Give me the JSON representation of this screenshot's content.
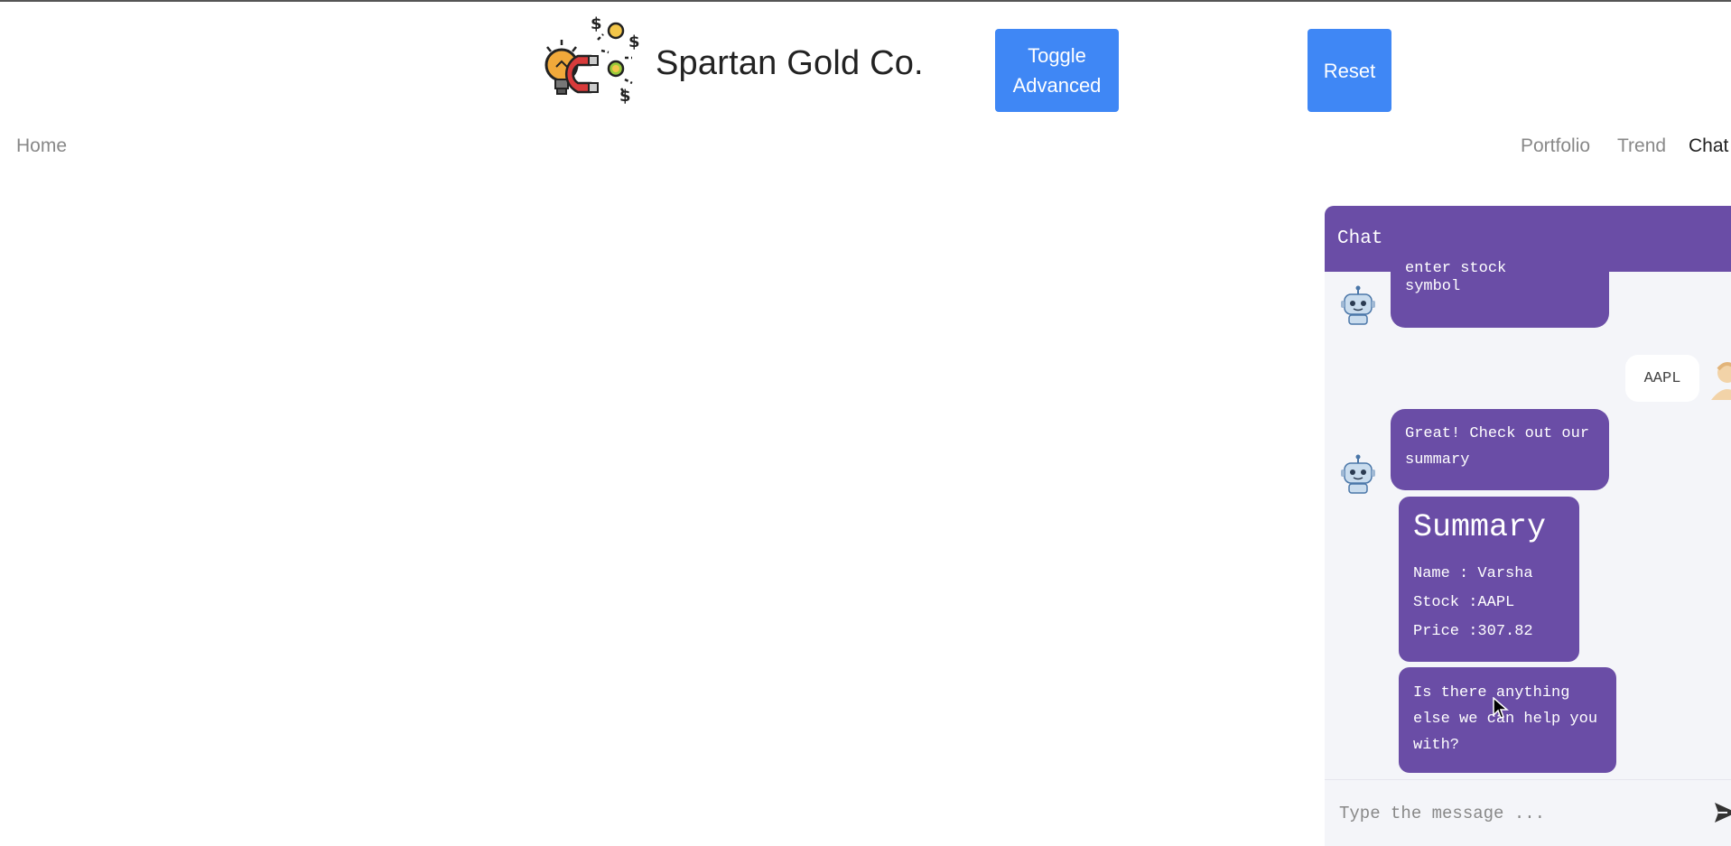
{
  "header": {
    "brand_title": "Spartan Gold Co.",
    "toggle_label": "Toggle Advanced",
    "reset_label": "Reset"
  },
  "nav": {
    "home": "Home",
    "portfolio": "Portfolio",
    "trend": "Trend",
    "chat": "Chat"
  },
  "chat": {
    "title": "Chat",
    "messages": [
      {
        "sender": "bot",
        "text_partial": "enter stock",
        "text": "symbol"
      },
      {
        "sender": "user",
        "text": "AAPL"
      },
      {
        "sender": "bot",
        "text": "Great! Check out our summary"
      },
      {
        "sender": "bot",
        "type": "summary",
        "title": "Summary",
        "name_line": "Name : Varsha",
        "stock_line": "Stock :AAPL",
        "price_line": "Price :307.82"
      },
      {
        "sender": "bot",
        "text": "Is there anything else we can help you with?"
      }
    ],
    "input_placeholder": "Type the message ...",
    "input_value": ""
  },
  "colors": {
    "accent_purple": "#6a4da6",
    "button_blue": "#3f87f5",
    "chat_bg": "#f4f5f9"
  },
  "icons": {
    "logo": "lightbulb-magnet-dollar-logo",
    "bot_avatar": "robot-icon",
    "user_avatar": "user-avatar-icon",
    "send": "send-arrow-icon"
  }
}
